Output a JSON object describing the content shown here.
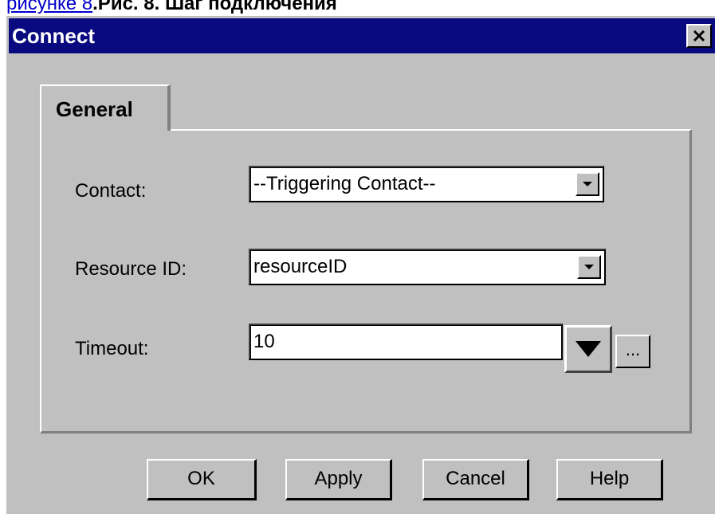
{
  "caption": {
    "link_text": "рисунке 8",
    "text": ".Рис. 8. Шаг подключения"
  },
  "dialog": {
    "title": "Connect",
    "close_label": "✕",
    "tab": "General",
    "fields": {
      "contact_label": "Contact:",
      "contact_value": "--Triggering Contact--",
      "resource_label": "Resource ID:",
      "resource_value": "resourceID",
      "timeout_label": "Timeout:",
      "timeout_value": "10",
      "ellipsis_label": "..."
    },
    "buttons": {
      "ok": "OK",
      "apply": "Apply",
      "cancel": "Cancel",
      "help": "Help"
    }
  },
  "colors": {
    "titlebar": "#0a0a80",
    "face": "#c0c0c0",
    "link": "#0000cc"
  },
  "icons": {
    "close": "close-icon",
    "dropdown": "chevron-down-icon"
  }
}
